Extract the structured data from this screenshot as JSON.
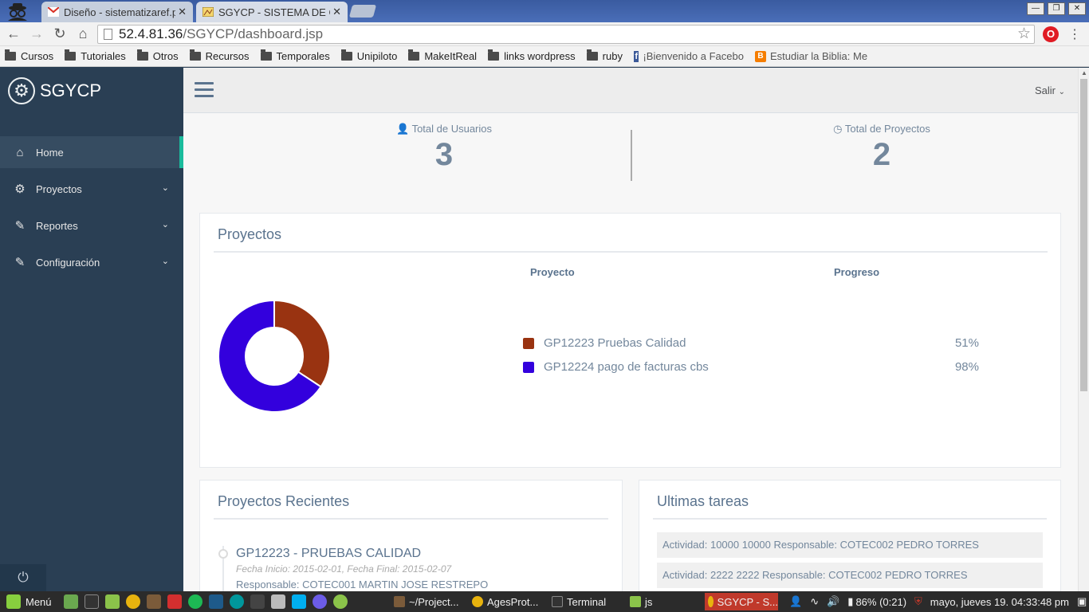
{
  "browser": {
    "tabs": [
      {
        "title": "Diseño - sistematizaref.p",
        "close": "✕"
      },
      {
        "title": "SGYCP - SISTEMA DE GE",
        "close": "✕"
      }
    ],
    "window_controls": {
      "minimize": "—",
      "restore": "❐",
      "close": "✕"
    },
    "url_host": "52.4.81.36",
    "url_path": "/SGYCP/dashboard.jsp",
    "bookmarks": [
      "Cursos",
      "Tutoriales",
      "Otros",
      "Recursos",
      "Temporales",
      "Unipiloto",
      "MakeItReal",
      "links wordpress",
      "ruby"
    ],
    "bookmark_facebook": "¡Bienvenido a Facebo",
    "bookmark_blogger": "Estudiar la Biblia: Me"
  },
  "sidebar": {
    "brand": "SGYCP",
    "items": [
      {
        "label": "Home",
        "icon": "home-icon"
      },
      {
        "label": "Proyectos",
        "icon": "gears-icon"
      },
      {
        "label": "Reportes",
        "icon": "edit-icon"
      },
      {
        "label": "Configuración",
        "icon": "edit-icon"
      }
    ]
  },
  "topnav": {
    "logout": "Salir"
  },
  "stats": {
    "users_label": "Total de Usuarios",
    "users_value": "3",
    "projects_label": "Total de Proyectos",
    "projects_value": "2"
  },
  "projects_panel": {
    "title": "Proyectos",
    "col_project": "Proyecto",
    "col_progress": "Progreso",
    "rows": [
      {
        "name": "GP12223 Pruebas Calidad",
        "progress": "51%",
        "color": "#993311"
      },
      {
        "name": "GP12224 pago de facturas cbs",
        "progress": "98%",
        "color": "#3300dd"
      }
    ]
  },
  "chart_data": {
    "type": "pie",
    "categories": [
      "GP12223 Pruebas Calidad",
      "GP12224 pago de facturas cbs"
    ],
    "values": [
      51,
      98
    ],
    "colors": [
      "#993311",
      "#3300dd"
    ],
    "title": "",
    "donut": true
  },
  "recent_panel": {
    "title": "Proyectos Recientes",
    "items": [
      {
        "title": "GP12223 - PRUEBAS CALIDAD",
        "dates": "Fecha Inicio: 2015-02-01, Fecha Final: 2015-02-07",
        "responsible": "Responsable: COTEC001 MARTIN JOSE RESTREPO"
      }
    ]
  },
  "tasks_panel": {
    "title": "Ultimas tareas",
    "items": [
      "Actividad: 10000 10000 Responsable: COTEC002 PEDRO TORRES",
      "Actividad: 2222 2222 Responsable: COTEC002 PEDRO TORRES"
    ]
  },
  "taskbar": {
    "menu": "Menú",
    "tasks": [
      "~/Project...",
      "AgesProt...",
      "Terminal",
      "js",
      "SGYCP - S..."
    ],
    "battery": "86% (0:21)",
    "clock": "mayo, jueves 19. 04:33:48 pm"
  }
}
